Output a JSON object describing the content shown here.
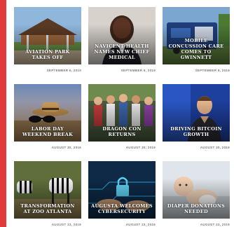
{
  "accent": "#e23a3a",
  "articles": [
    {
      "title": "Aviation Park Takes Off",
      "date": "September 6, 2019",
      "scene": "pavilion-photo"
    },
    {
      "title": "Navicent Health Names New Chief Medical",
      "date": "September 6, 2019",
      "scene": "portrait-photo"
    },
    {
      "title": "Mobile Concussion Care Comes to Gwinnett",
      "date": "September 6, 2019",
      "scene": "trailer-photo"
    },
    {
      "title": "Labor Day Weekend Break",
      "date": "August 30, 2019",
      "scene": "sunglasses-hat-photo"
    },
    {
      "title": "Dragon Con Returns",
      "date": "August 30, 2019",
      "scene": "costume-crowd-photo"
    },
    {
      "title": "Driving Bitcoin Growth",
      "date": "August 30, 2019",
      "scene": "bitpay-photo"
    },
    {
      "title": "Transformation at Zoo Atlanta",
      "date": "August 23, 2019",
      "scene": "zebras-photo"
    },
    {
      "title": "Augusta Welcomes Cybersecurity",
      "date": "August 23, 2019",
      "scene": "lock-circuit-photo"
    },
    {
      "title": "Diaper Donations Needed",
      "date": "August 23, 2019",
      "scene": "baby-photo"
    }
  ]
}
